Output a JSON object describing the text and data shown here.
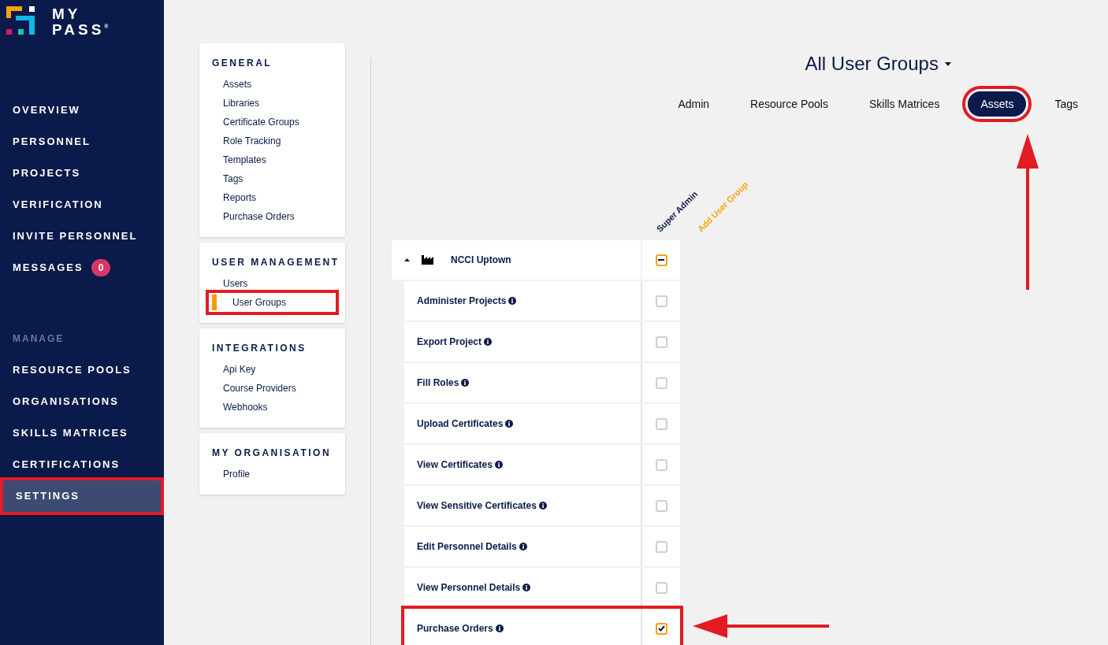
{
  "brand": {
    "line_1": "MY",
    "line_2": "PASS",
    "mark": "®"
  },
  "nav": [
    {
      "label": "OVERVIEW",
      "selected": false,
      "highlighted": false
    },
    {
      "label": "PERSONNEL",
      "selected": false,
      "highlighted": false
    },
    {
      "label": "PROJECTS",
      "selected": false,
      "highlighted": false
    },
    {
      "label": "VERIFICATION",
      "selected": false,
      "highlighted": false
    },
    {
      "label": "INVITE PERSONNEL",
      "selected": false,
      "highlighted": false
    },
    {
      "label": "MESSAGES",
      "badge": "0",
      "selected": false,
      "highlighted": false
    }
  ],
  "manage": {
    "heading": "MANAGE",
    "items": [
      {
        "label": "RESOURCE POOLS",
        "selected": false,
        "highlighted": false
      },
      {
        "label": "ORGANISATIONS",
        "selected": false,
        "highlighted": false
      },
      {
        "label": "SKILLS MATRICES",
        "selected": false,
        "highlighted": false
      },
      {
        "label": "CERTIFICATIONS",
        "selected": false,
        "highlighted": false
      },
      {
        "label": "SETTINGS",
        "selected": true,
        "highlighted": true
      }
    ]
  },
  "settings_sections": [
    {
      "heading": "GENERAL",
      "items": [
        {
          "label": "Assets",
          "selected": false,
          "highlighted": false
        },
        {
          "label": "Libraries",
          "selected": false,
          "highlighted": false
        },
        {
          "label": "Certificate Groups",
          "selected": false,
          "highlighted": false
        },
        {
          "label": "Role Tracking",
          "selected": false,
          "highlighted": false
        },
        {
          "label": "Templates",
          "selected": false,
          "highlighted": false
        },
        {
          "label": "Tags",
          "selected": false,
          "highlighted": false
        },
        {
          "label": "Reports",
          "selected": false,
          "highlighted": false
        },
        {
          "label": "Purchase Orders",
          "selected": false,
          "highlighted": false
        }
      ]
    },
    {
      "heading": "USER MANAGEMENT",
      "items": [
        {
          "label": "Users",
          "selected": false,
          "highlighted": false
        },
        {
          "label": "User Groups",
          "selected": true,
          "highlighted": true
        }
      ]
    },
    {
      "heading": "INTEGRATIONS",
      "items": [
        {
          "label": "Api Key",
          "selected": false,
          "highlighted": false
        },
        {
          "label": "Course Providers",
          "selected": false,
          "highlighted": false
        },
        {
          "label": "Webhooks",
          "selected": false,
          "highlighted": false
        }
      ]
    },
    {
      "heading": "MY ORGANISATION",
      "items": [
        {
          "label": "Profile",
          "selected": false,
          "highlighted": false
        }
      ]
    }
  ],
  "page_title": "All User Groups",
  "tabs": [
    {
      "label": "Admin",
      "selected": false,
      "highlighted": false
    },
    {
      "label": "Resource Pools",
      "selected": false,
      "highlighted": false
    },
    {
      "label": "Skills Matrices",
      "selected": false,
      "highlighted": false
    },
    {
      "label": "Assets",
      "selected": true,
      "highlighted": true
    },
    {
      "label": "Tags",
      "selected": false,
      "highlighted": false
    }
  ],
  "columns": [
    {
      "label": "Super Admin",
      "kind": "group"
    },
    {
      "label": "Add User Group",
      "kind": "add"
    }
  ],
  "group": {
    "name": "NCCI Uptown",
    "expanded": true,
    "indeterminate": true
  },
  "permissions": [
    {
      "label": "Administer Projects",
      "checked": false,
      "highlighted": false
    },
    {
      "label": "Export Project",
      "checked": false,
      "highlighted": false
    },
    {
      "label": "Fill Roles",
      "checked": false,
      "highlighted": false
    },
    {
      "label": "Upload Certificates",
      "checked": false,
      "highlighted": false
    },
    {
      "label": "View Certificates",
      "checked": false,
      "highlighted": false
    },
    {
      "label": "View Sensitive Certificates",
      "checked": false,
      "highlighted": false
    },
    {
      "label": "Edit Personnel Details",
      "checked": false,
      "highlighted": false
    },
    {
      "label": "View Personnel Details",
      "checked": false,
      "highlighted": false
    },
    {
      "label": "Purchase Orders",
      "checked": true,
      "highlighted": true
    }
  ]
}
